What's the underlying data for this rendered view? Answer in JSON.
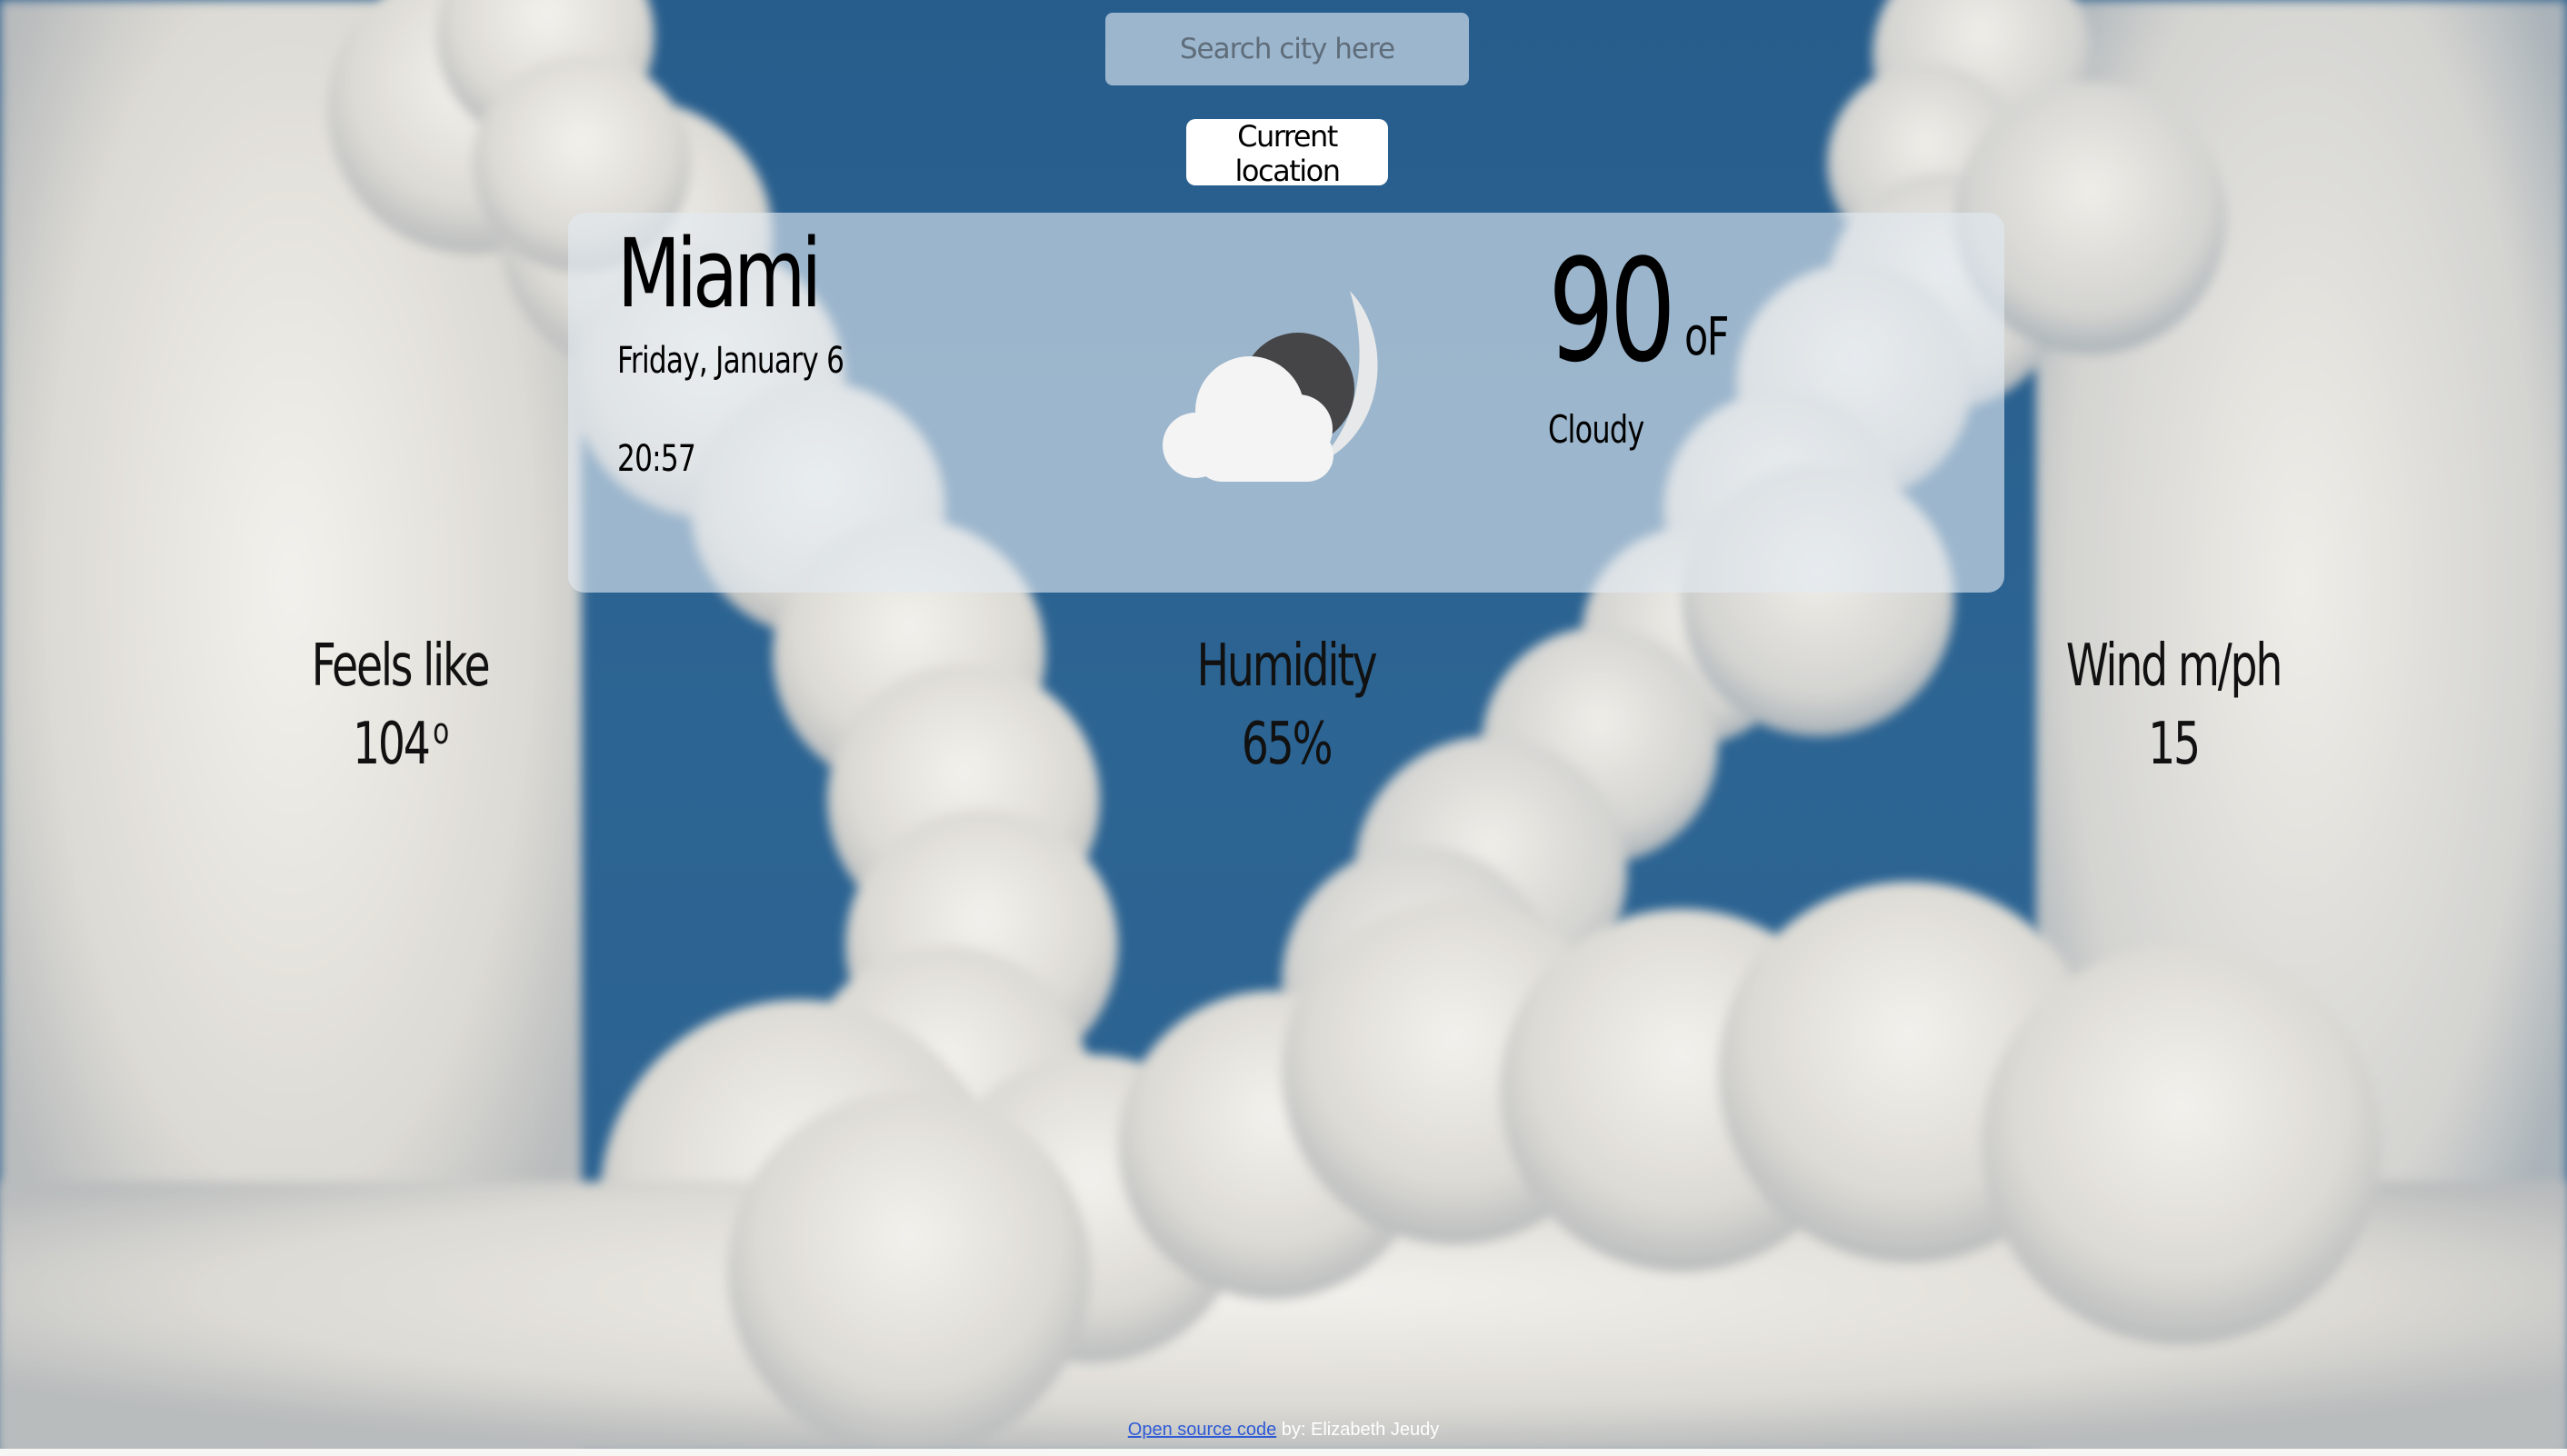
{
  "search": {
    "placeholder": "Search city here",
    "value": ""
  },
  "location_button": {
    "label": "Current location"
  },
  "weather": {
    "city": "Miami",
    "date": "Friday, January 6",
    "time": "20:57",
    "temperature": "90",
    "unit": "oF",
    "description": "Cloudy",
    "icon": "cloudy-night-icon"
  },
  "stats": {
    "feels_like": {
      "label": "Feels like",
      "value": "104",
      "unit": "o"
    },
    "humidity": {
      "label": "Humidity",
      "value": "65%"
    },
    "wind": {
      "label": "Wind m/ph",
      "value": "15"
    }
  },
  "footer": {
    "link_text": "Open source code",
    "author_text": " by: Elizabeth Jeudy"
  },
  "colors": {
    "sky": "#2a6190",
    "card": "#e2eaf2",
    "cloud": "#e9e7e2"
  }
}
